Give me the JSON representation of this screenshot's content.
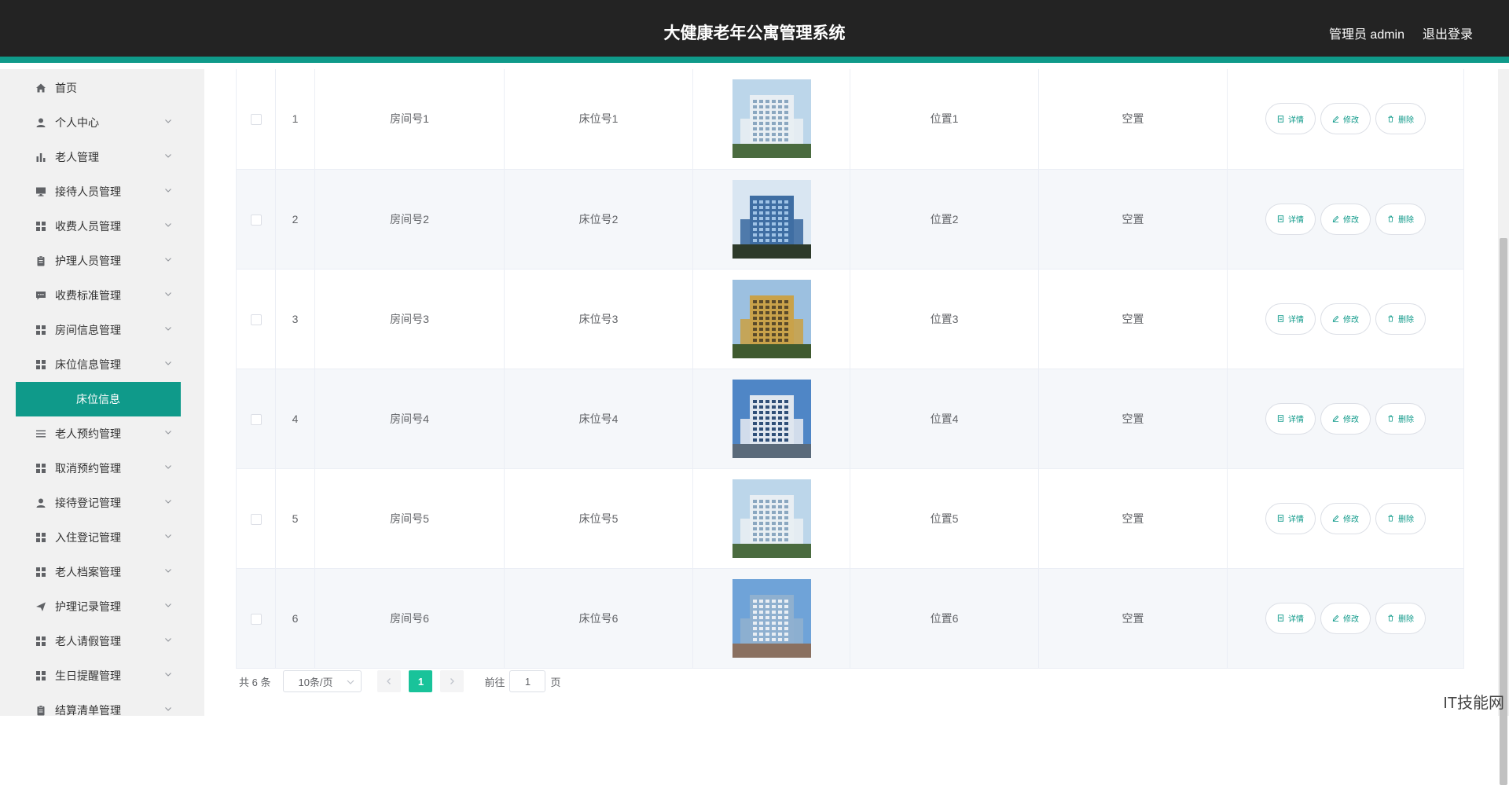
{
  "header": {
    "title": "大健康老年公寓管理系统",
    "user": "管理员 admin",
    "logout": "退出登录"
  },
  "sidebar": {
    "items": [
      {
        "label": "首页",
        "icon": "home-icon"
      },
      {
        "label": "个人中心",
        "icon": "user-icon"
      },
      {
        "label": "老人管理",
        "icon": "chart-icon"
      },
      {
        "label": "接待人员管理",
        "icon": "monitor-icon"
      },
      {
        "label": "收费人员管理",
        "icon": "grid-icon"
      },
      {
        "label": "护理人员管理",
        "icon": "clipboard-icon"
      },
      {
        "label": "收费标准管理",
        "icon": "message-icon"
      },
      {
        "label": "房间信息管理",
        "icon": "grid-icon"
      },
      {
        "label": "床位信息管理",
        "icon": "grid-icon"
      },
      {
        "label": "老人预约管理",
        "icon": "list-icon"
      },
      {
        "label": "取消预约管理",
        "icon": "grid-icon"
      },
      {
        "label": "接待登记管理",
        "icon": "user-icon"
      },
      {
        "label": "入住登记管理",
        "icon": "grid-icon"
      },
      {
        "label": "老人档案管理",
        "icon": "grid-icon"
      },
      {
        "label": "护理记录管理",
        "icon": "send-icon"
      },
      {
        "label": "老人请假管理",
        "icon": "grid-icon"
      },
      {
        "label": "生日提醒管理",
        "icon": "grid-icon"
      },
      {
        "label": "结算清单管理",
        "icon": "clipboard-icon"
      }
    ],
    "active_sub": "床位信息"
  },
  "table": {
    "rows": [
      {
        "index": "1",
        "room": "房间号1",
        "bed": "床位号1",
        "position": "位置1",
        "status": "空置"
      },
      {
        "index": "2",
        "room": "房间号2",
        "bed": "床位号2",
        "position": "位置2",
        "status": "空置"
      },
      {
        "index": "3",
        "room": "房间号3",
        "bed": "床位号3",
        "position": "位置3",
        "status": "空置"
      },
      {
        "index": "4",
        "room": "房间号4",
        "bed": "床位号4",
        "position": "位置4",
        "status": "空置"
      },
      {
        "index": "5",
        "room": "房间号5",
        "bed": "床位号5",
        "position": "位置5",
        "status": "空置"
      },
      {
        "index": "6",
        "room": "房间号6",
        "bed": "床位号6",
        "position": "位置6",
        "status": "空置"
      }
    ],
    "actions": {
      "detail": "详情",
      "edit": "修改",
      "delete": "删除"
    }
  },
  "pagination": {
    "total": "共 6 条",
    "page_size": "10条/页",
    "current_page": "1",
    "goto_label": "前往",
    "goto_value": "1",
    "page_unit": "页"
  },
  "watermark": "IT技能网",
  "colors": {
    "accent": "#0f9a8a",
    "header_bg": "#232323",
    "page_active": "#19c39a"
  }
}
